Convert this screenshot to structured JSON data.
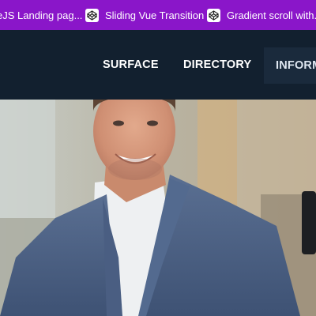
{
  "bookmarks": [
    {
      "label": "eJS Landing pag...",
      "icon": "codepen-icon"
    },
    {
      "label": "Sliding Vue Transition",
      "icon": "codepen-icon"
    },
    {
      "label": "Gradient scroll with...",
      "icon": "codepen-icon"
    }
  ],
  "nav": {
    "items": [
      {
        "label": "SURFACE"
      },
      {
        "label": "DIRECTORY"
      },
      {
        "label": "INFORM"
      }
    ]
  },
  "colors": {
    "bookmark_bar": "#8a16c9",
    "header": "#12202f",
    "nav_text": "#ffffff"
  }
}
